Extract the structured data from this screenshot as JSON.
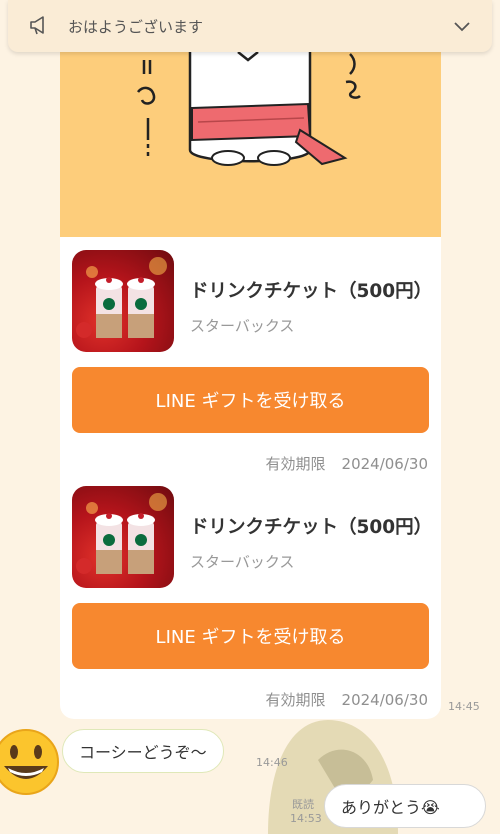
{
  "banner": {
    "text": "おはようございます",
    "icon": "megaphone-icon",
    "toggle_icon": "chevron-down-icon"
  },
  "gift_card": {
    "items": [
      {
        "title": "ドリンクチケット（500円）",
        "brand": "スターバックス",
        "button": "LINE ギフトを受け取る",
        "expiry_label": "有効期限",
        "expiry_date": "2024/06/30"
      },
      {
        "title": "ドリンクチケット（500円）",
        "brand": "スターバックス",
        "button": "LINE ギフトを受け取る",
        "expiry_label": "有効期限",
        "expiry_date": "2024/06/30"
      }
    ],
    "time": "14:45"
  },
  "incoming": {
    "text": "コーシーどうぞ〜",
    "time": "14:46"
  },
  "outgoing": {
    "text": "ありがとう😭",
    "read": "既読",
    "time": "14:53"
  },
  "colors": {
    "background": "#fdf3e3",
    "accent": "#f7882f",
    "sticker_bg": "#fdcd7b"
  }
}
